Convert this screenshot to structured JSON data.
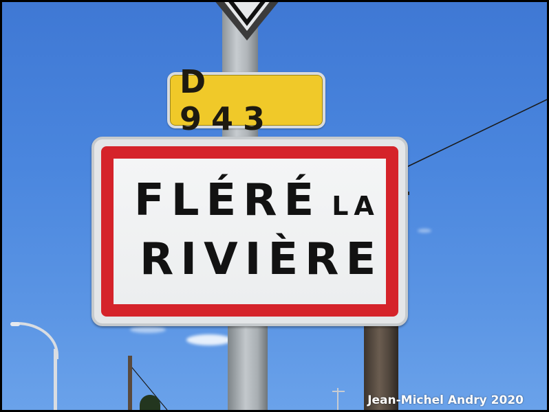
{
  "photo": {
    "colors": {
      "sky": "#4a86de",
      "town_sign_border": "#d5232a",
      "town_sign_face": "#eceeef",
      "road_plate": "#f0c929",
      "lettering": "#121212"
    }
  },
  "road_plate": {
    "text": "D 943"
  },
  "town_sign": {
    "line1_main": "FLÉRÉ",
    "line1_small": "LA",
    "line2": "RIVIÈRE"
  },
  "watermark": {
    "text": "Jean-Michel Andry 2020"
  }
}
